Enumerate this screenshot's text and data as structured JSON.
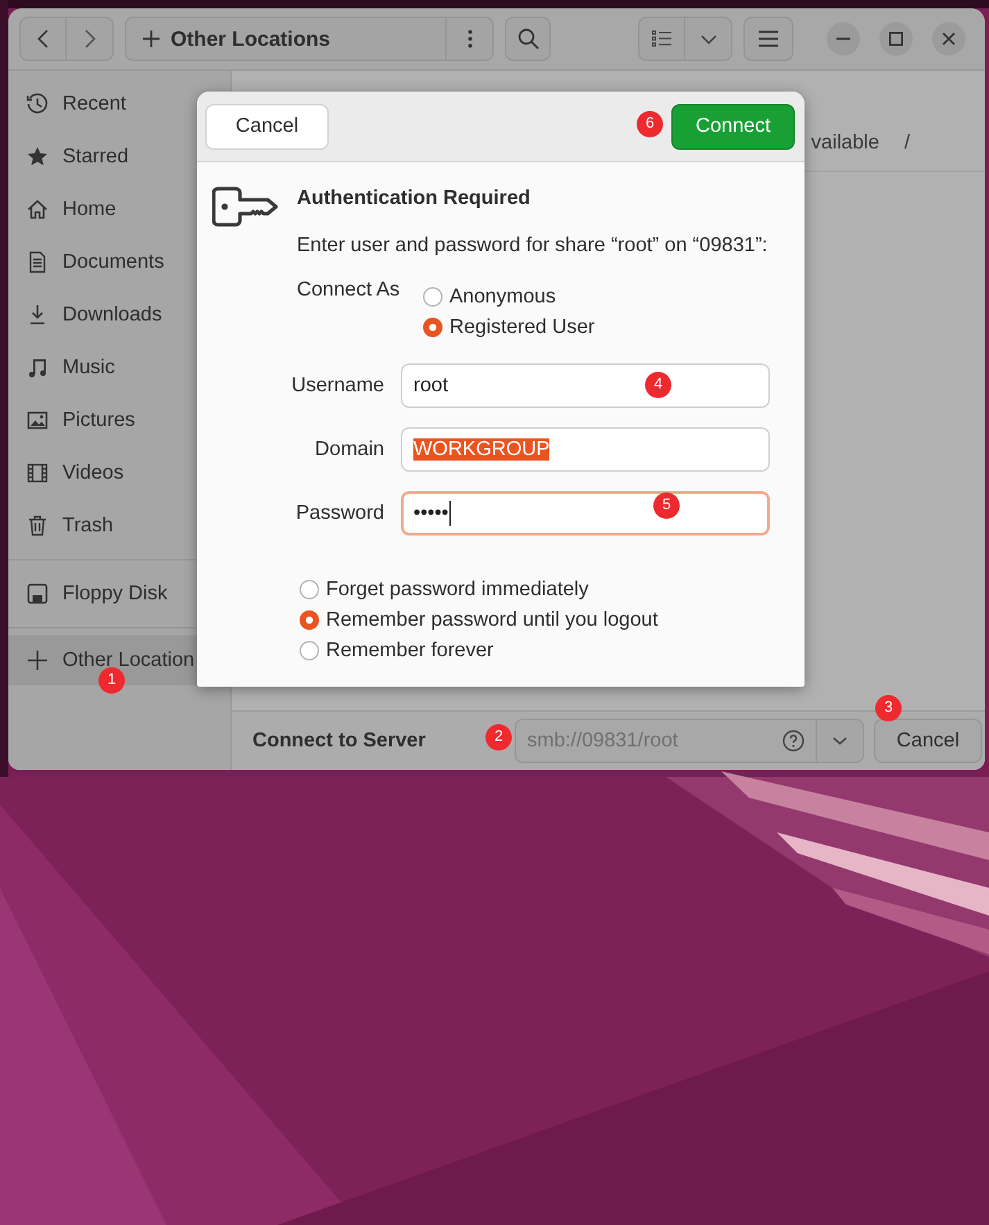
{
  "toolbar": {
    "location": "Other Locations"
  },
  "sidebar": {
    "groups": [
      {
        "items": [
          {
            "label": "Recent",
            "selected": false
          },
          {
            "label": "Starred",
            "selected": false
          },
          {
            "label": "Home",
            "selected": false
          },
          {
            "label": "Documents",
            "selected": false
          },
          {
            "label": "Downloads",
            "selected": false
          },
          {
            "label": "Music",
            "selected": false
          },
          {
            "label": "Pictures",
            "selected": false
          },
          {
            "label": "Videos",
            "selected": false
          },
          {
            "label": "Trash",
            "selected": false
          }
        ]
      },
      {
        "items": [
          {
            "label": "Floppy Disk",
            "selected": false
          }
        ]
      },
      {
        "items": [
          {
            "label": "Other Location",
            "selected": true
          }
        ]
      }
    ]
  },
  "main": {
    "row_texts": [
      "vailable",
      "/"
    ]
  },
  "dialog": {
    "cancel": "Cancel",
    "connect": "Connect",
    "title": "Authentication Required",
    "message": "Enter user and password for share “root” on “09831”:",
    "connect_as": {
      "label": "Connect As",
      "options": [
        {
          "label": "Anonymous",
          "selected": false
        },
        {
          "label": "Registered User",
          "selected": true
        }
      ]
    },
    "fields": [
      {
        "label": "Username",
        "value": "root",
        "focused": false,
        "text_selected": false
      },
      {
        "label": "Domain",
        "value": "WORKGROUP",
        "focused": false,
        "text_selected": true
      },
      {
        "label": "Password",
        "value": "•••••",
        "focused": true,
        "text_selected": false
      }
    ],
    "remember": [
      {
        "label": "Forget password immediately",
        "selected": false
      },
      {
        "label": "Remember password until you logout",
        "selected": true
      },
      {
        "label": "Remember forever",
        "selected": false
      }
    ]
  },
  "connect_bar": {
    "label": "Connect to Server",
    "address": "smb://09831/root",
    "cancel": "Cancel"
  },
  "annotations": [
    {
      "label": "1"
    },
    {
      "label": "2"
    },
    {
      "label": "3"
    },
    {
      "label": "4"
    },
    {
      "label": "5"
    },
    {
      "label": "6"
    }
  ]
}
